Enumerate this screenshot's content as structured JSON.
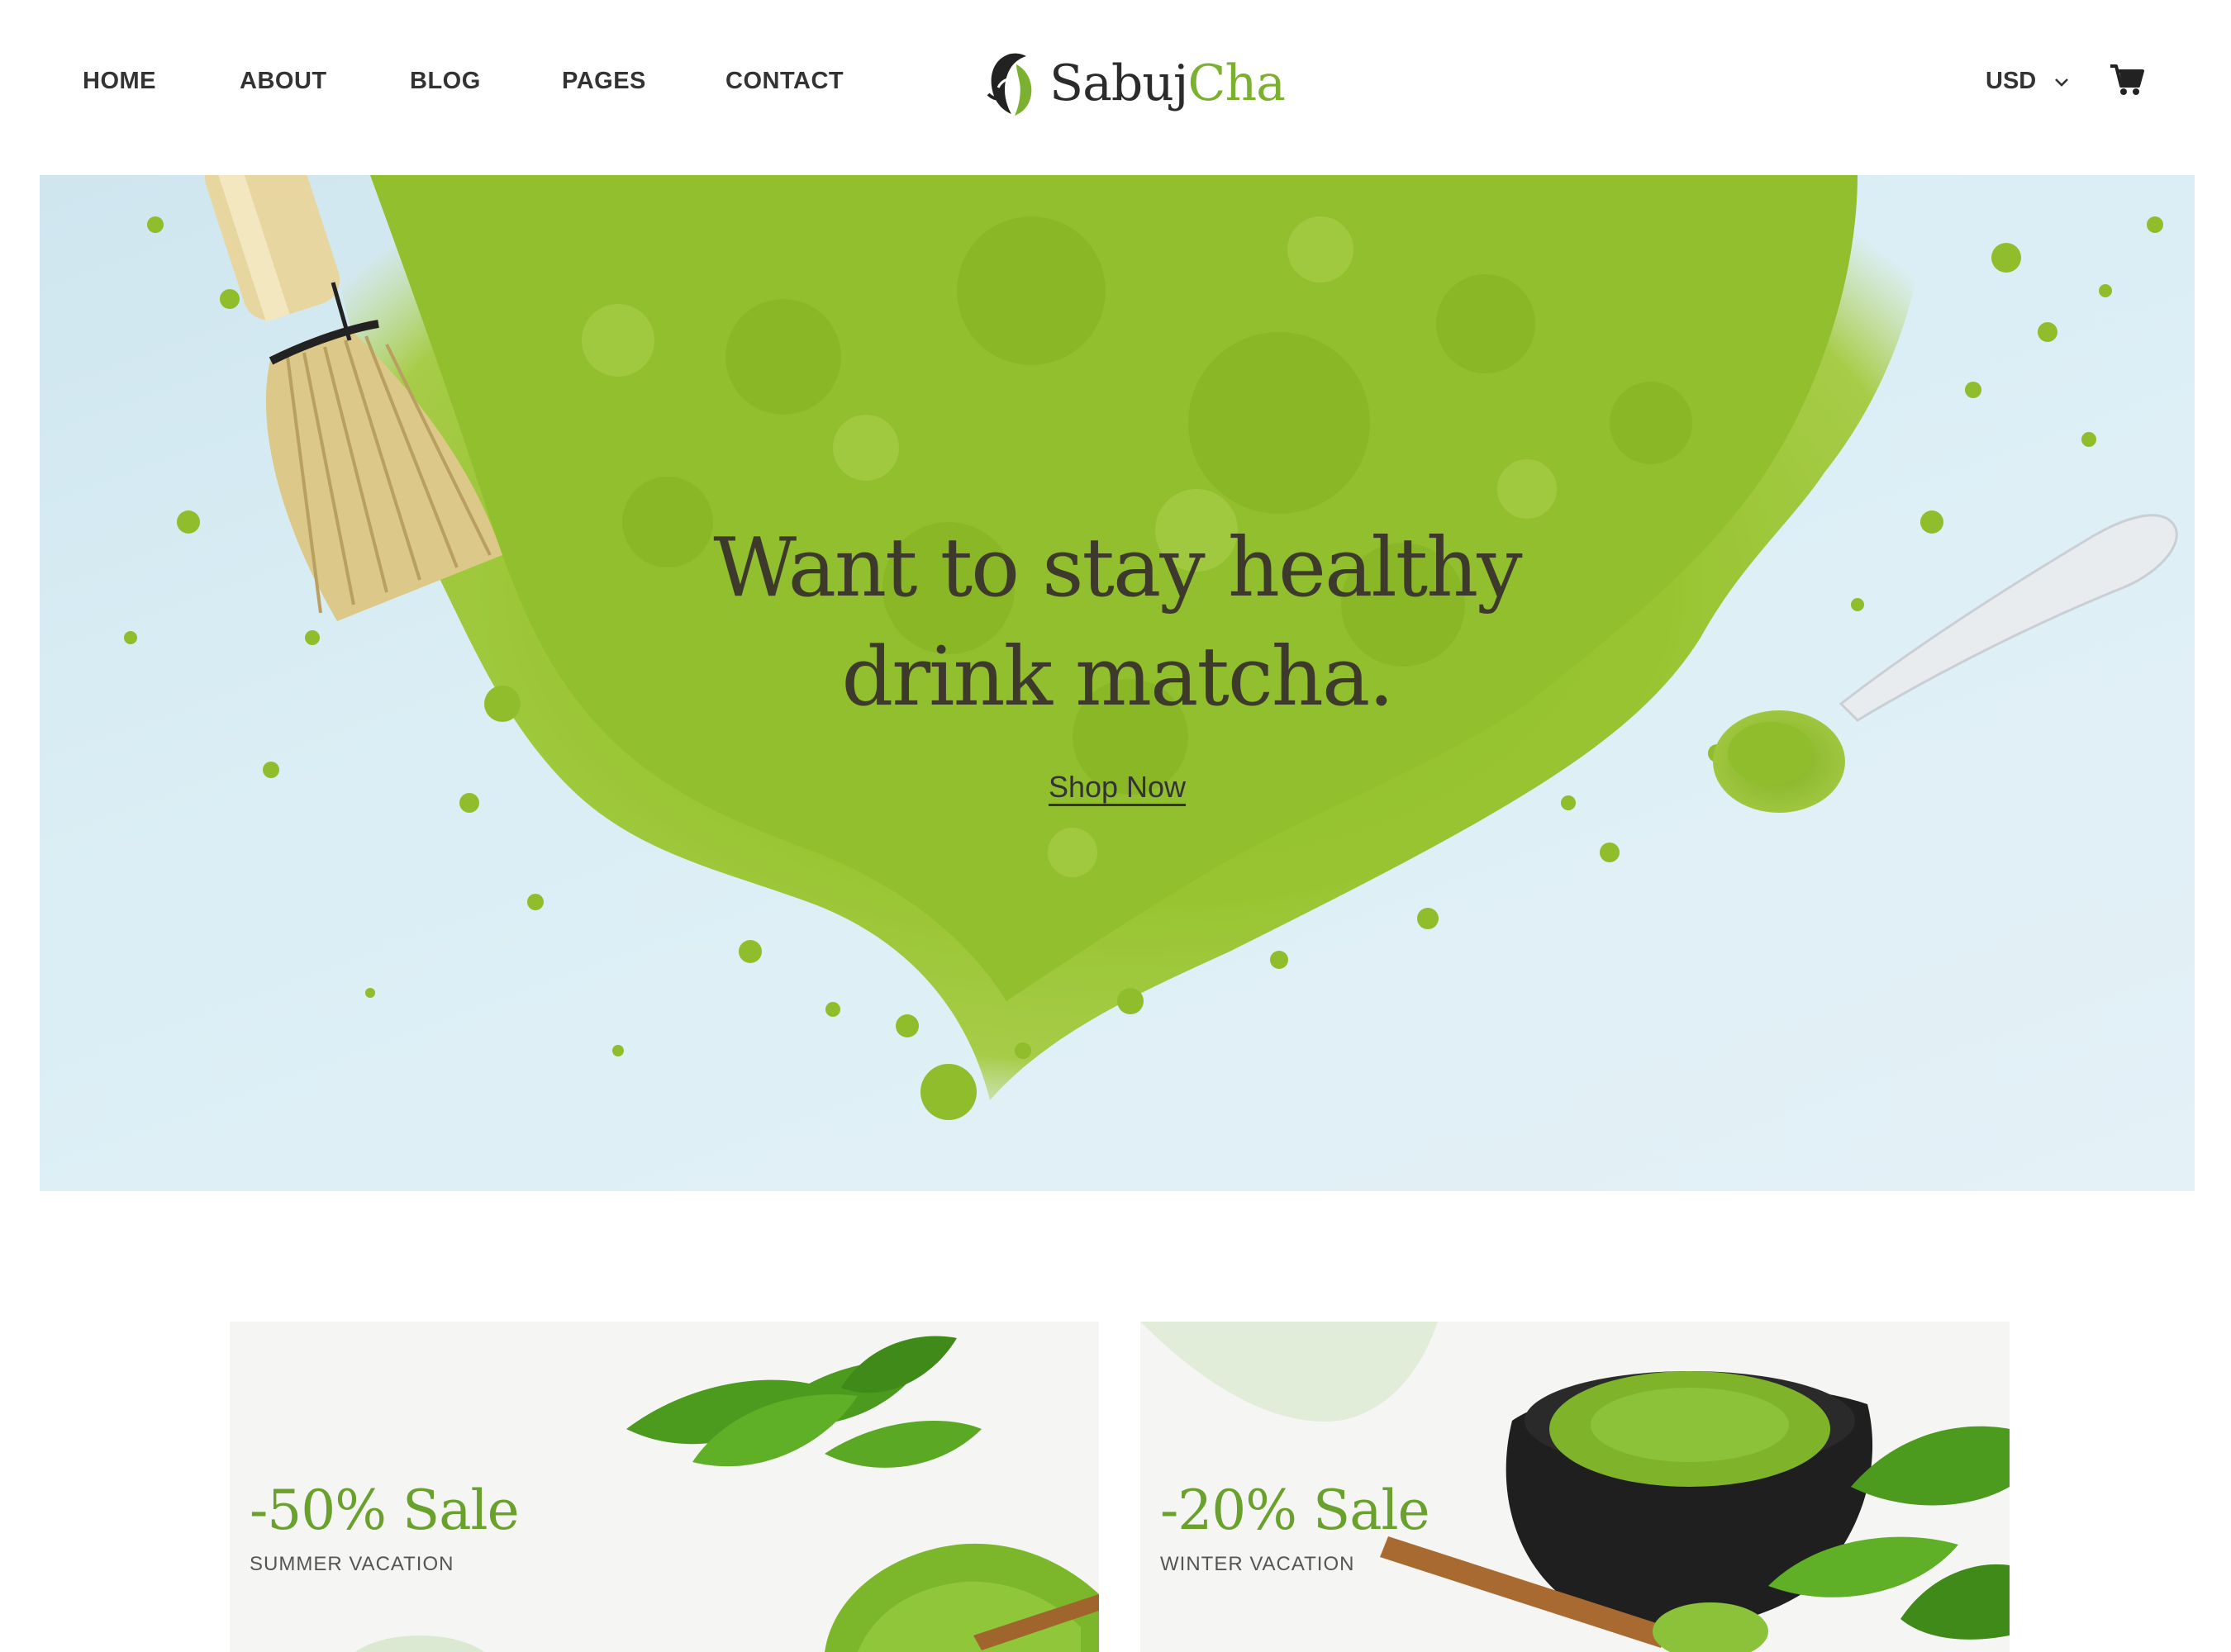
{
  "nav": {
    "items": [
      {
        "label": "HOME"
      },
      {
        "label": "ABOUT"
      },
      {
        "label": "BLOG"
      },
      {
        "label": "PAGES"
      },
      {
        "label": "CONTACT"
      }
    ]
  },
  "brand": {
    "name_part1": "Sabuj",
    "name_part2": "Cha",
    "accent_color": "#7bb030"
  },
  "header": {
    "currency": "USD",
    "cart_icon": "shopping-cart-icon"
  },
  "hero": {
    "title_line1": "Want to stay healthy",
    "title_line2": "drink matcha.",
    "cta_label": "Shop Now"
  },
  "promos": [
    {
      "sale": "-50% Sale",
      "subtitle": "SUMMER VACATION"
    },
    {
      "sale": "-20% Sale",
      "subtitle": "WINTER VACATION"
    }
  ]
}
